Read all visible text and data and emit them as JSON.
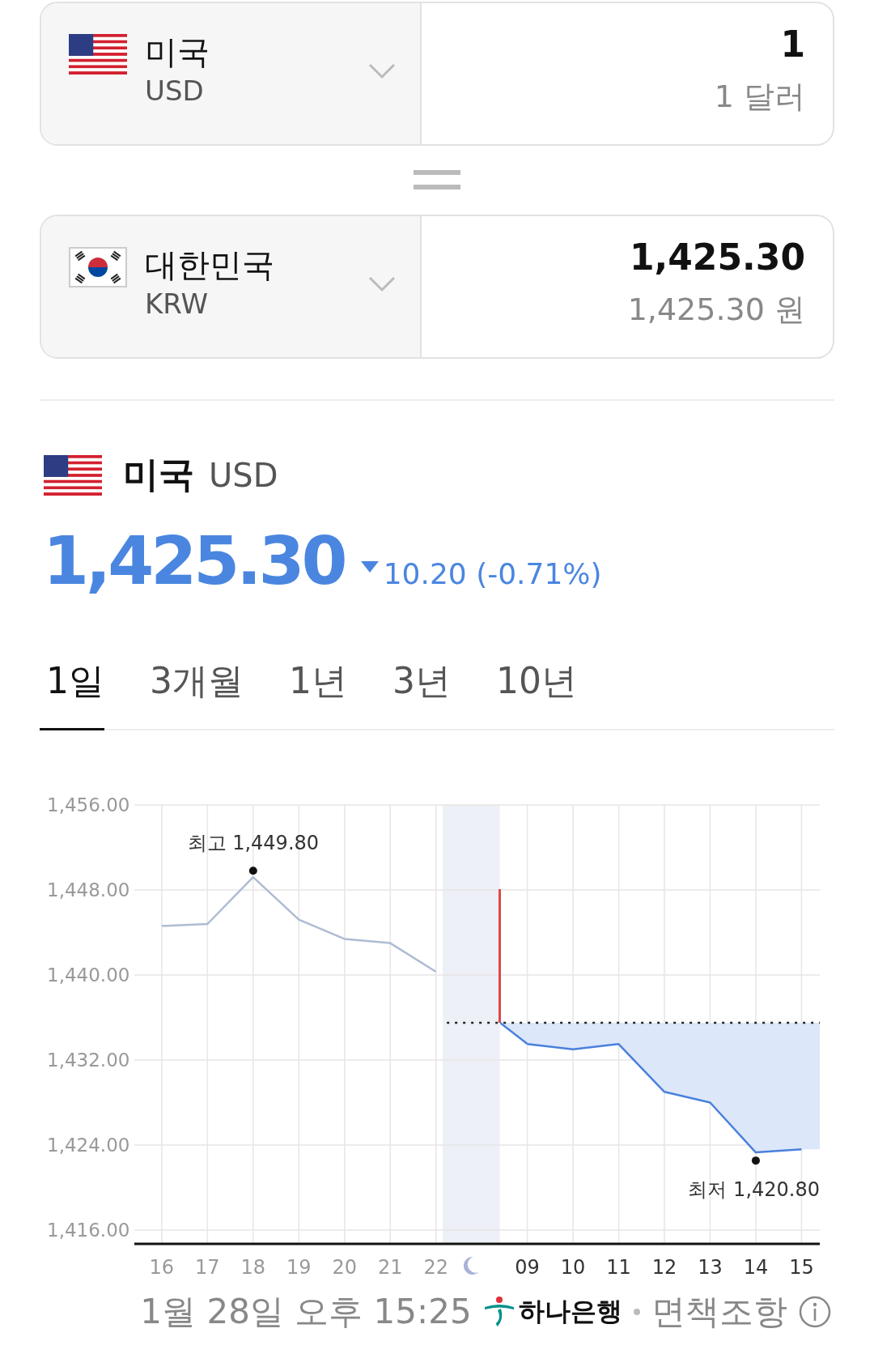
{
  "converter": [
    {
      "country": "미국",
      "code": "USD",
      "amount": "1",
      "amount_text": "1 달러"
    },
    {
      "country": "대한민국",
      "code": "KRW",
      "amount": "1,425.30",
      "amount_text": "1,425.30 원"
    }
  ],
  "quote": {
    "country": "미국",
    "code": "USD",
    "price": "1,425.30",
    "falling": true,
    "change": "10.20 (-0.71%)"
  },
  "tabs": [
    {
      "label": "1일",
      "selected": true
    },
    {
      "label": "3개월",
      "selected": false
    },
    {
      "label": "1년",
      "selected": false
    },
    {
      "label": "3년",
      "selected": false
    },
    {
      "label": "10년",
      "selected": false
    }
  ],
  "chart": {
    "chart_data": {
      "type": "line",
      "grid": true,
      "categories": [
        "16",
        "17",
        "18",
        "19",
        "20",
        "21",
        "22",
        "09",
        "10",
        "11",
        "12",
        "13",
        "14",
        "15"
      ],
      "series": [
        {
          "color": "#aebbd3",
          "values": [
            1444.6,
            1444.8,
            1449.2,
            1445.2,
            1443.4,
            1443,
            1440.3,
            null,
            null,
            null,
            null,
            null,
            null,
            null
          ]
        },
        {
          "color": "#4a80dc",
          "values": [
            null,
            null,
            null,
            null,
            null,
            null,
            null,
            1433.5,
            1433,
            1433.5,
            1429,
            1428,
            1423.3,
            1423.6
          ]
        }
      ],
      "ylim": [
        1414.7,
        1456
      ],
      "yticks": [
        {
          "value": 1456,
          "label": "1,456.00"
        },
        {
          "value": 1448,
          "label": "1,448.00"
        },
        {
          "value": 1440,
          "label": "1,440.00"
        },
        {
          "value": 1432,
          "label": "1,432.00"
        },
        {
          "value": 1424,
          "label": "1,424.00"
        },
        {
          "value": 1416,
          "label": "1,416.00"
        }
      ],
      "ref_lines": [
        {
          "axis": "y",
          "value": 1435.5
        }
      ],
      "annotations": [
        "최고 1,449.80",
        "최저 1,420.80"
      ]
    }
  },
  "footer": {
    "timestamp": "1월 28일 오후 15:25",
    "provider": "하나은행",
    "disclaimer": "면책조항"
  }
}
